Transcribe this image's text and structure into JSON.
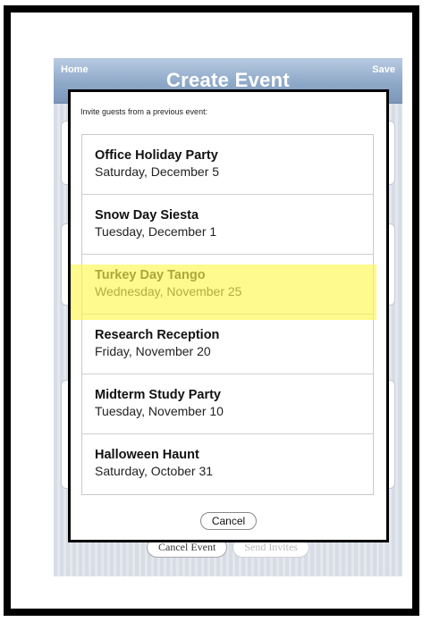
{
  "navbar": {
    "home_label": "Home",
    "title": "Create Event",
    "save_label": "Save"
  },
  "page_actions": {
    "cancel_event_label": "Cancel Event",
    "send_invites_label": "Send Invites"
  },
  "modal": {
    "prompt": "Invite guests from a previous event:",
    "events": [
      {
        "name": "Office Holiday Party",
        "date": "Saturday, December 5"
      },
      {
        "name": "Snow Day Siesta",
        "date": "Tuesday, December 1"
      },
      {
        "name": "Turkey Day Tango",
        "date": "Wednesday, November 25",
        "highlighted": true
      },
      {
        "name": "Research Reception",
        "date": "Friday, November 20"
      },
      {
        "name": "Midterm Study Party",
        "date": "Tuesday, November 10"
      },
      {
        "name": "Halloween Haunt",
        "date": "Saturday, October 31"
      }
    ],
    "cancel_label": "Cancel"
  },
  "colors": {
    "navbar": "#8fa9c9",
    "highlight": "#fff750",
    "frame": "#000000"
  }
}
